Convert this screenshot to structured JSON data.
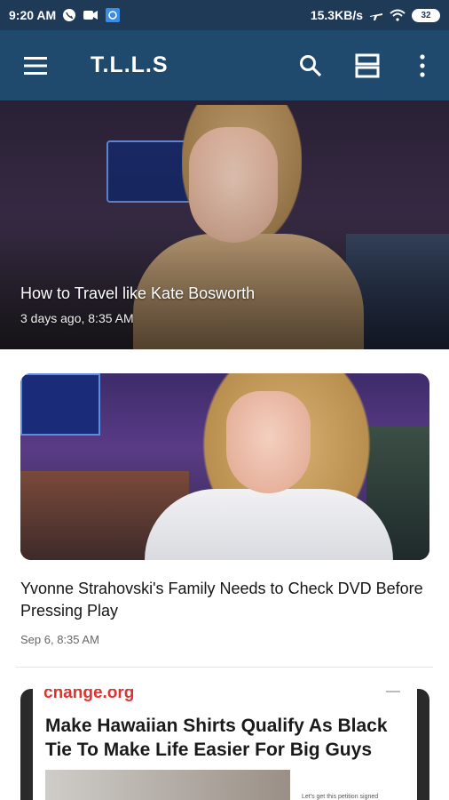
{
  "status_bar": {
    "time": "9:20 AM",
    "net_speed": "15.3KB/s",
    "battery": "32",
    "icons": [
      "whatsapp-icon",
      "video-icon",
      "app-icon",
      "airplane-icon",
      "wifi-icon",
      "battery-icon"
    ]
  },
  "app_bar": {
    "title": "T.L.L.S",
    "icons": [
      "menu-icon",
      "search-icon",
      "view-toggle-icon",
      "more-vert-icon"
    ],
    "background": "#1f4a6e"
  },
  "hero": {
    "title": "How to Travel like Kate Bosworth",
    "meta": "3 days ago, 8:35 AM"
  },
  "articles": [
    {
      "title": "Yvonne Strahovski's Family Needs to Check DVD Before Pressing Play",
      "meta": "Sep 6, 8:35 AM"
    },
    {
      "image_brand": "change.org",
      "image_headline": "Make Hawaiian Shirts Qualify As Black Tie To Make Life Easier For Big Guys",
      "image_note": "Let's get this petition signed"
    }
  ]
}
